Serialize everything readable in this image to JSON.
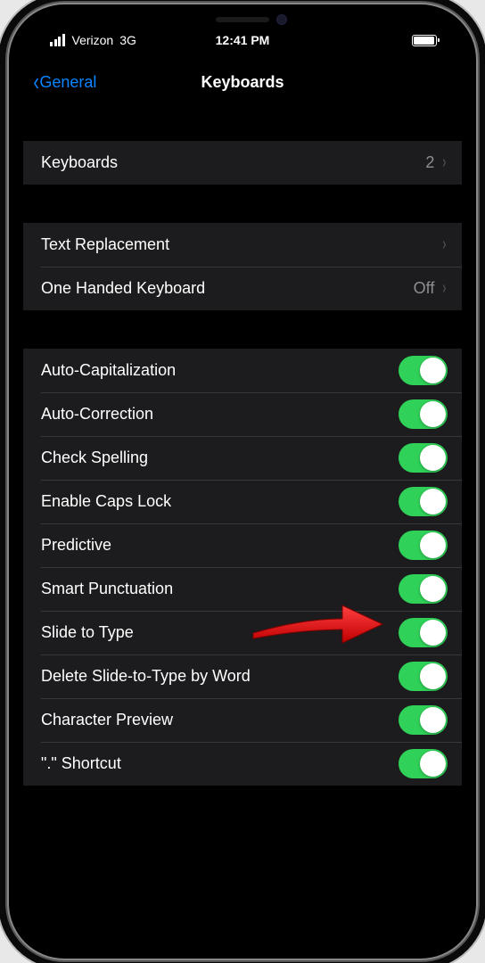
{
  "status": {
    "carrier": "Verizon",
    "network": "3G",
    "time": "12:41 PM"
  },
  "nav": {
    "back": "General",
    "title": "Keyboards"
  },
  "group1": {
    "keyboards": {
      "label": "Keyboards",
      "value": "2"
    }
  },
  "group2": {
    "textReplacement": {
      "label": "Text Replacement"
    },
    "oneHanded": {
      "label": "One Handed Keyboard",
      "value": "Off"
    }
  },
  "group3": {
    "items": [
      {
        "label": "Auto-Capitalization",
        "on": true
      },
      {
        "label": "Auto-Correction",
        "on": true
      },
      {
        "label": "Check Spelling",
        "on": true
      },
      {
        "label": "Enable Caps Lock",
        "on": true
      },
      {
        "label": "Predictive",
        "on": true,
        "highlight": true
      },
      {
        "label": "Smart Punctuation",
        "on": true
      },
      {
        "label": "Slide to Type",
        "on": true
      },
      {
        "label": "Delete Slide-to-Type by Word",
        "on": true
      },
      {
        "label": "Character Preview",
        "on": true
      },
      {
        "label": "\".\" Shortcut",
        "on": true
      }
    ]
  }
}
